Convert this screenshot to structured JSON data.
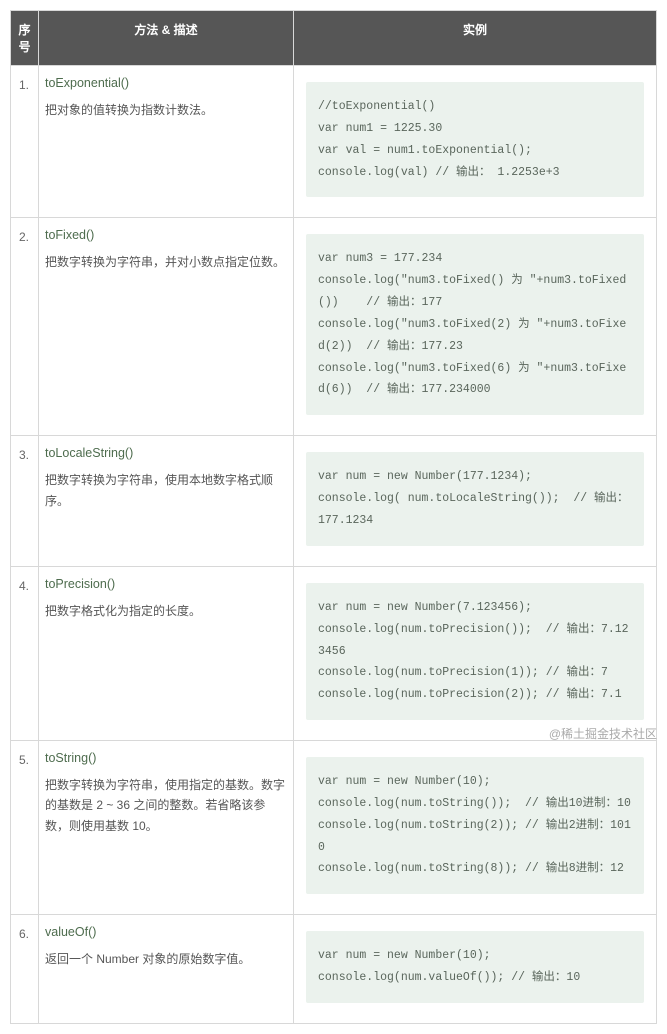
{
  "headers": {
    "index": "序号",
    "desc": "方法 & 描述",
    "example": "实例"
  },
  "rows": [
    {
      "n": "1.",
      "method": "toExponential()",
      "text": "把对象的值转换为指数计数法。",
      "code": "//toExponential()\nvar num1 = 1225.30\nvar val = num1.toExponential();\nconsole.log(val) // 输出： 1.2253e+3"
    },
    {
      "n": "2.",
      "method": "toFixed()",
      "text": "把数字转换为字符串，并对小数点指定位数。",
      "code": "var num3 = 177.234\nconsole.log(\"num3.toFixed() 为 \"+num3.toFixed())    // 输出：177\nconsole.log(\"num3.toFixed(2) 为 \"+num3.toFixed(2))  // 输出：177.23\nconsole.log(\"num3.toFixed(6) 为 \"+num3.toFixed(6))  // 输出：177.234000"
    },
    {
      "n": "3.",
      "method": "toLocaleString()",
      "text": "把数字转换为字符串，使用本地数字格式顺序。",
      "code": "var num = new Number(177.1234);\nconsole.log( num.toLocaleString());  // 输出：177.1234"
    },
    {
      "n": "4.",
      "method": "toPrecision()",
      "text": "把数字格式化为指定的长度。",
      "code": "var num = new Number(7.123456);\nconsole.log(num.toPrecision());  // 输出：7.123456\nconsole.log(num.toPrecision(1)); // 输出：7\nconsole.log(num.toPrecision(2)); // 输出：7.1"
    },
    {
      "n": "5.",
      "method": "toString()",
      "text": "把数字转换为字符串，使用指定的基数。数字的基数是 2 ~ 36 之间的整数。若省略该参数，则使用基数 10。",
      "code": "var num = new Number(10);\nconsole.log(num.toString());  // 输出10进制：10\nconsole.log(num.toString(2)); // 输出2进制：1010\nconsole.log(num.toString(8)); // 输出8进制：12"
    },
    {
      "n": "6.",
      "method": "valueOf()",
      "text": "返回一个 Number 对象的原始数字值。",
      "code": "var num = new Number(10);\nconsole.log(num.valueOf()); // 输出：10"
    }
  ],
  "watermark": "@稀土掘金技术社区"
}
